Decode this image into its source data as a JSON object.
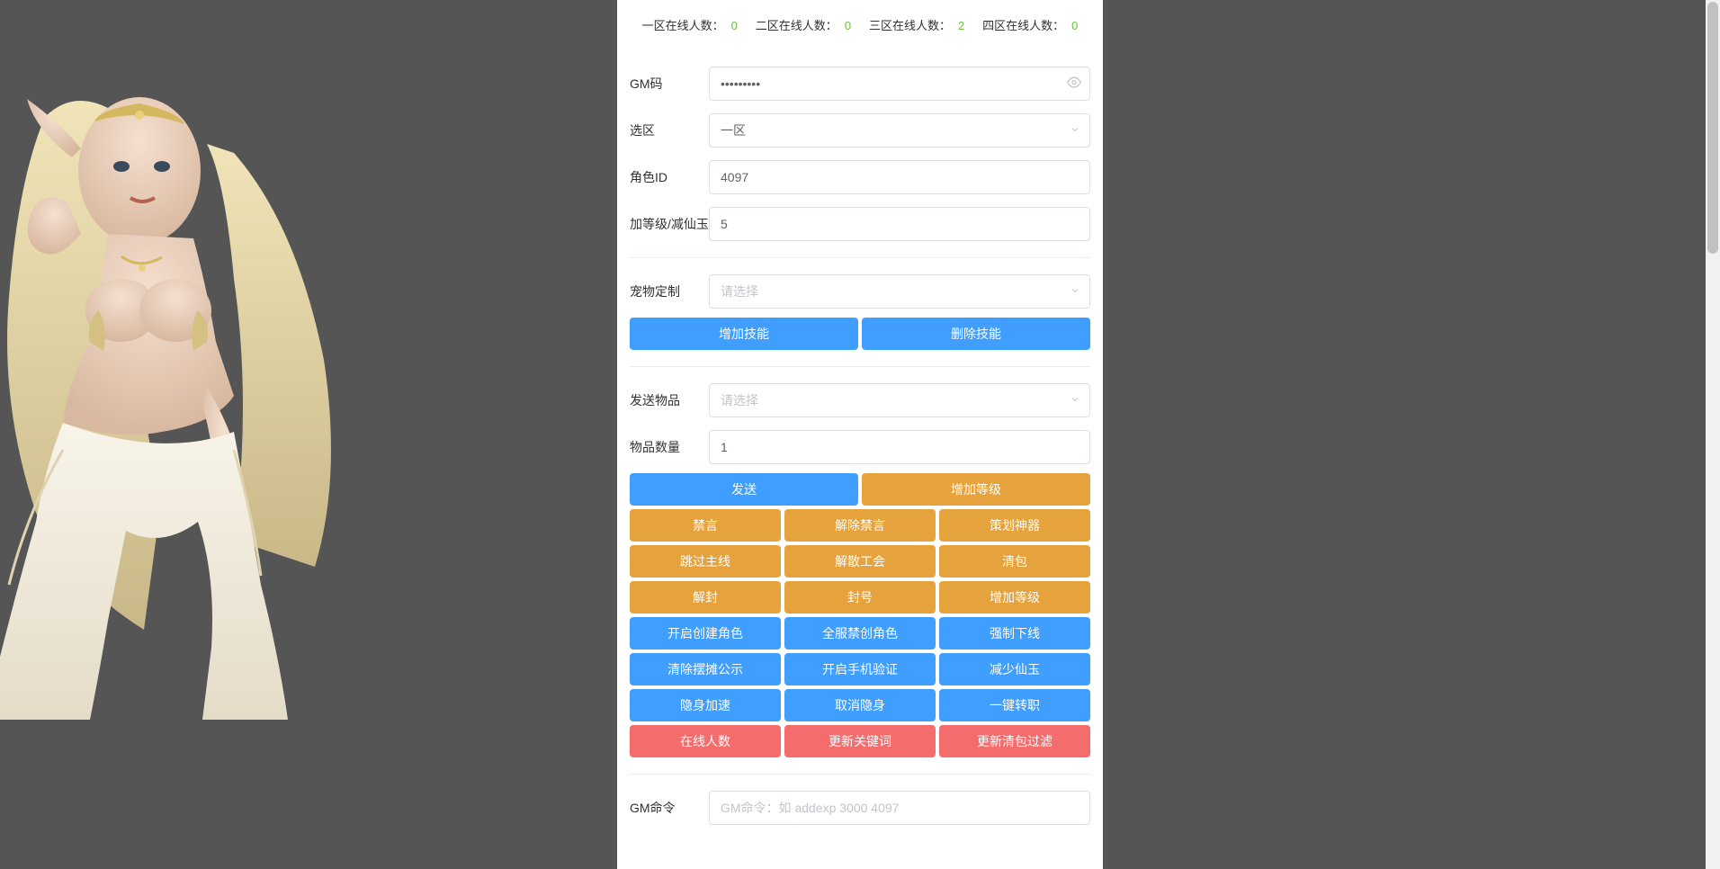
{
  "stats": [
    {
      "label": "一区在线人数：",
      "value": "0"
    },
    {
      "label": "二区在线人数：",
      "value": "0"
    },
    {
      "label": "三区在线人数：",
      "value": "2"
    },
    {
      "label": "四区在线人数：",
      "value": "0"
    }
  ],
  "form": {
    "gm_code_label": "GM码",
    "gm_code_value": "•••••••••",
    "zone_label": "选区",
    "zone_value": "一区",
    "role_id_label": "角色ID",
    "role_id_value": "4097",
    "level_label": "加等级/减仙玉",
    "level_value": "5",
    "pet_label": "宠物定制",
    "pet_placeholder": "请选择",
    "send_item_label": "发送物品",
    "send_item_placeholder": "请选择",
    "item_count_label": "物品数量",
    "item_count_value": "1",
    "gm_cmd_label": "GM命令",
    "gm_cmd_placeholder": "GM命令：如 addexp 3000 4097"
  },
  "buttons": {
    "skill_add": "增加技能",
    "skill_del": "删除技能",
    "send": "发送",
    "lvlup1": "增加等级",
    "row1": [
      "禁言",
      "解除禁言",
      "策划神器"
    ],
    "row2": [
      "跳过主线",
      "解散工会",
      "清包"
    ],
    "row3": [
      "解封",
      "封号",
      "增加等级"
    ],
    "row4": [
      "开启创建角色",
      "全服禁创角色",
      "强制下线"
    ],
    "row5": [
      "清除摆摊公示",
      "开启手机验证",
      "减少仙玉"
    ],
    "row6": [
      "隐身加速",
      "取消隐身",
      "一键转职"
    ],
    "row7": [
      "在线人数",
      "更新关键词",
      "更新清包过滤"
    ]
  }
}
